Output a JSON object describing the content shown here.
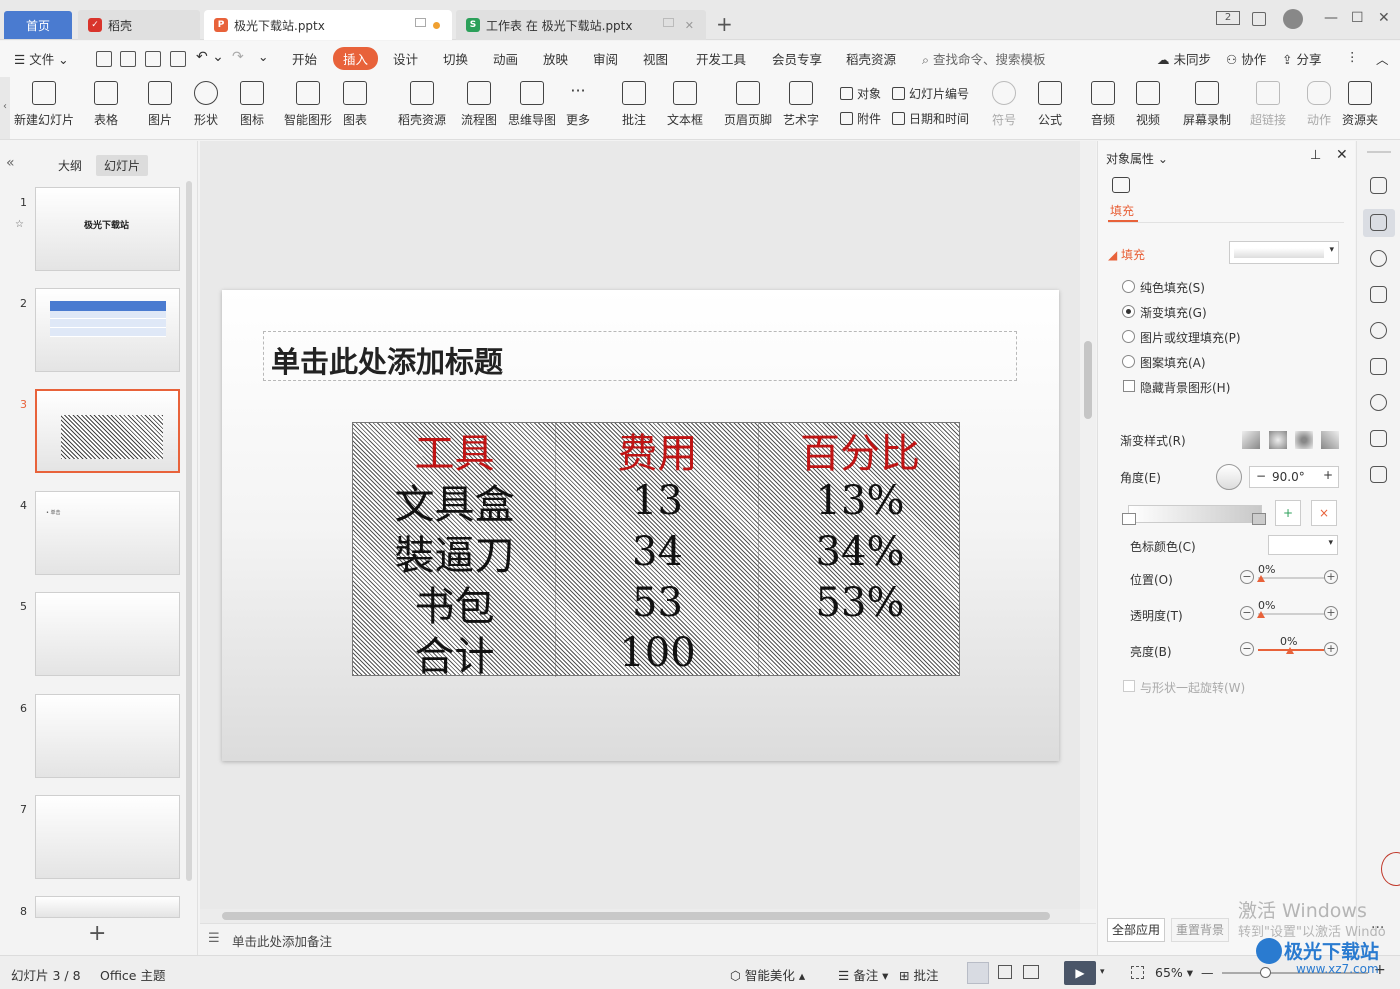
{
  "tabs": {
    "home": "首页",
    "docer": "稻壳",
    "ppt_file": "极光下载站.pptx",
    "xls_file": "工作表 在 极光下载站.pptx"
  },
  "window": {
    "page_indicator": "2"
  },
  "menu": {
    "file": "文件",
    "items": [
      "开始",
      "插入",
      "设计",
      "切换",
      "动画",
      "放映",
      "审阅",
      "视图",
      "开发工具",
      "会员专享",
      "稻壳资源"
    ],
    "search": "查找命令、搜索模板",
    "sync": "未同步",
    "collab": "协作",
    "share": "分享"
  },
  "ribbon": {
    "new_slide": "新建幻灯片",
    "table": "表格",
    "image": "图片",
    "shape": "形状",
    "icon": "图标",
    "smart": "智能图形",
    "chart": "图表",
    "docer_res": "稻壳资源",
    "flowchart": "流程图",
    "mindmap": "思维导图",
    "more": "更多",
    "comment": "批注",
    "textbox": "文本框",
    "header_footer": "页眉页脚",
    "wordart": "艺术字",
    "object": "对象",
    "attachment": "附件",
    "slide_number": "幻灯片编号",
    "datetime": "日期和时间",
    "symbol": "符号",
    "formula": "公式",
    "audio": "音频",
    "video": "视频",
    "screen_rec": "屏幕录制",
    "hyperlink": "超链接",
    "action": "动作",
    "resource": "资源夹"
  },
  "left_panel": {
    "outline": "大纲",
    "slides": "幻灯片",
    "thumb1_title": "极光下载站",
    "thumb4_text": "• 单击",
    "numbers": [
      "1",
      "2",
      "3",
      "4",
      "5",
      "6",
      "7",
      "8"
    ]
  },
  "slide": {
    "title_placeholder": "单击此处添加标题",
    "table": {
      "headers": [
        "工具",
        "费用",
        "百分比"
      ],
      "rows": [
        [
          "文具盒",
          "13",
          "13%"
        ],
        [
          "裝逼刀",
          "34",
          "34%"
        ],
        [
          "书包",
          "53",
          "53%"
        ],
        [
          "合计",
          "100",
          ""
        ]
      ]
    }
  },
  "notes_placeholder": "单击此处添加备注",
  "right_panel": {
    "header": "对象属性",
    "tab_fill": "填充",
    "section_fill": "填充",
    "solid": "纯色填充(S)",
    "gradient": "渐变填充(G)",
    "picture": "图片或纹理填充(P)",
    "pattern": "图案填充(A)",
    "hide_bg": "隐藏背景图形(H)",
    "gradient_style": "渐变样式(R)",
    "angle": "角度(E)",
    "angle_value": "90.0°",
    "stop_color": "色标颜色(C)",
    "position": "位置(O)",
    "position_value": "0%",
    "transparency": "透明度(T)",
    "transparency_value": "0%",
    "brightness": "亮度(B)",
    "brightness_value": "0%",
    "rotate_with_shape": "与形状一起旋转(W)",
    "apply_all": "全部应用",
    "reset_bg": "重置背景"
  },
  "status": {
    "slide_info": "幻灯片 3 / 8",
    "theme": "Office 主题",
    "smart_beautify": "智能美化",
    "notes": "备注",
    "comment": "批注",
    "zoom": "65%"
  },
  "watermark": {
    "activate": "激活 Windows",
    "goto": "转到\"设置\"以激活 Windo",
    "site": "极光下载站",
    "url": "www.xz7.com"
  },
  "colors": {
    "accent": "#e8623a",
    "home_tab": "#4a7bd0",
    "table_header": "#c01414"
  }
}
